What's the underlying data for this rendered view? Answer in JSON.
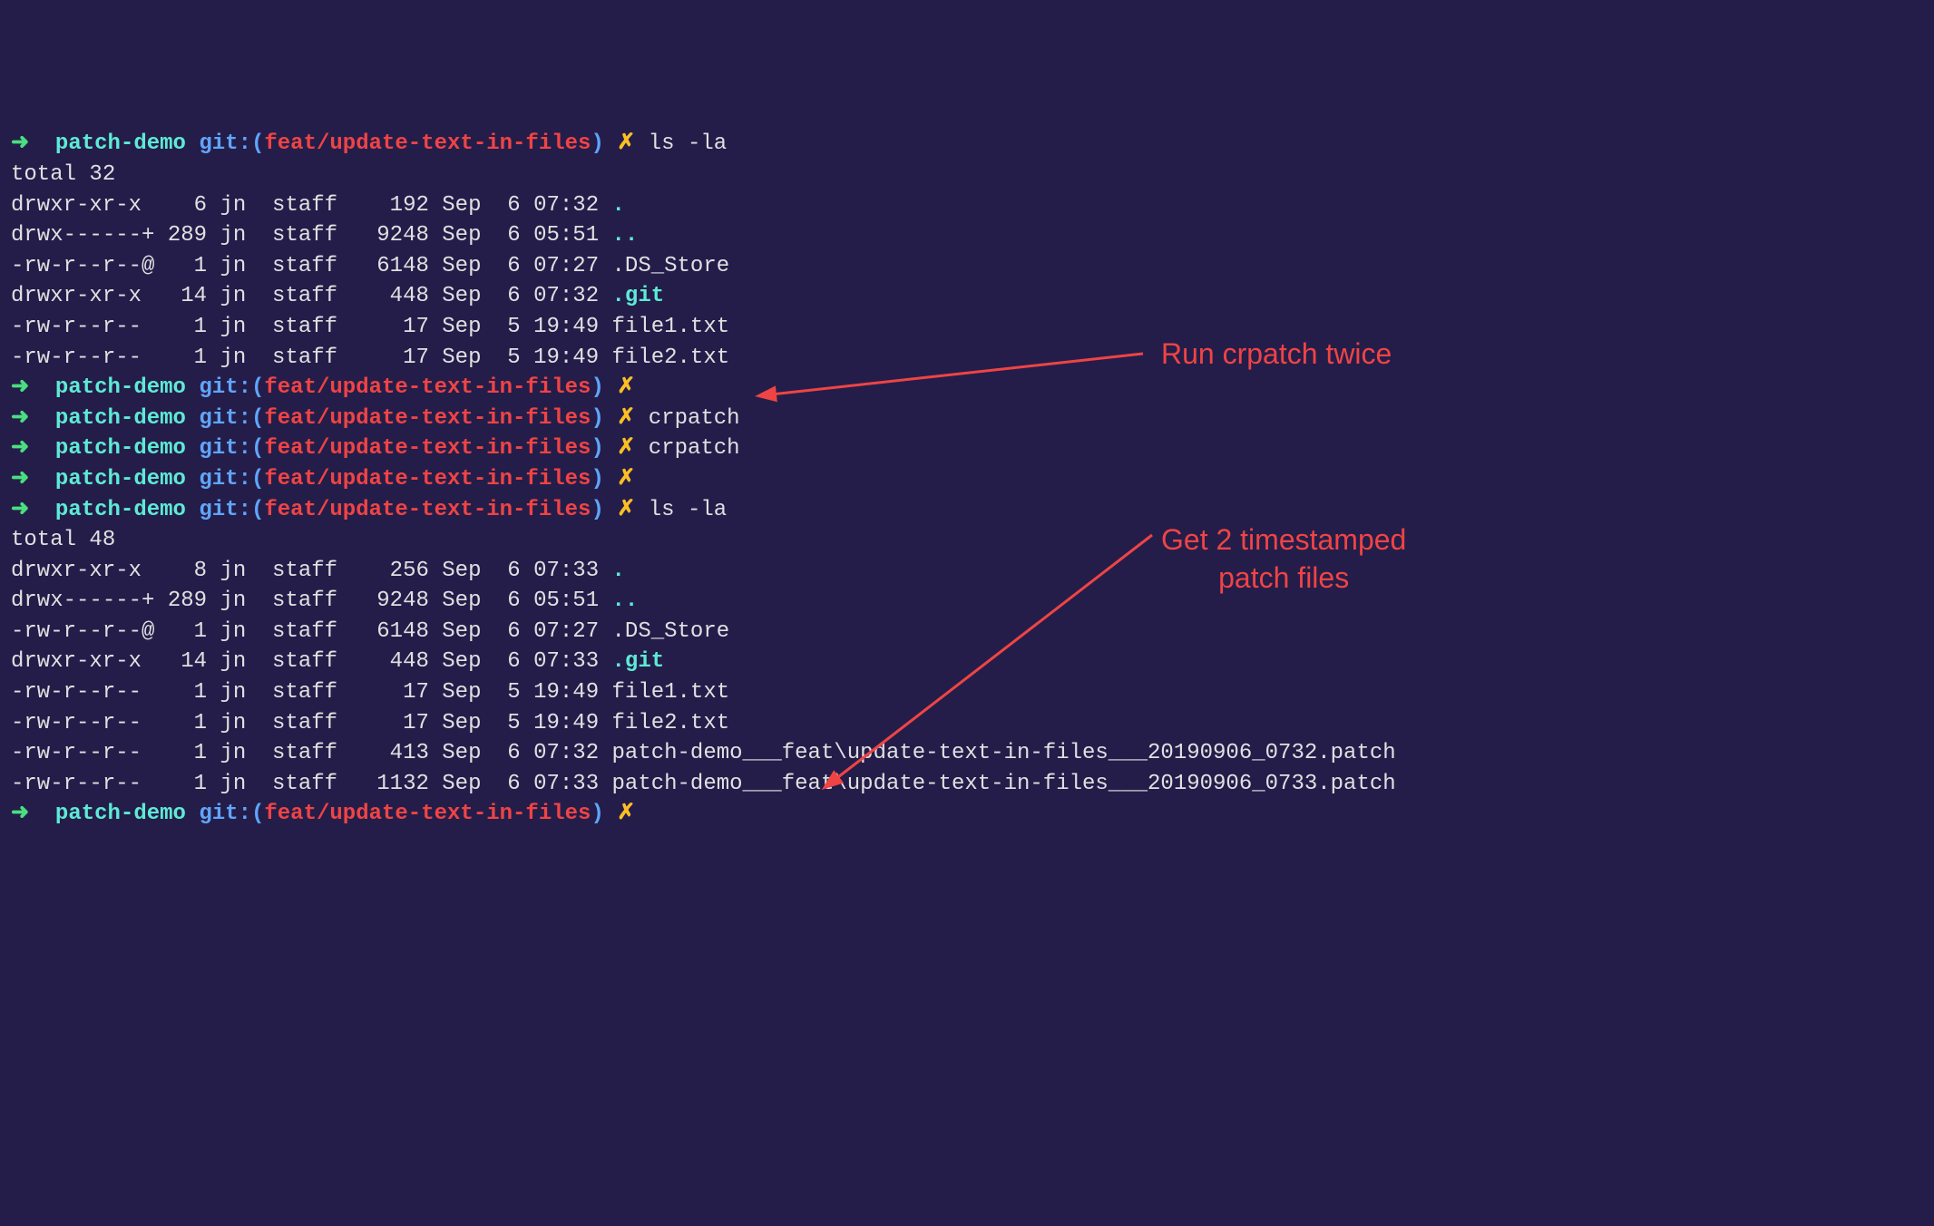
{
  "prompt": {
    "arrow": "➜",
    "dir": "patch-demo",
    "git_label": "git:(",
    "branch": "feat/update-text-in-files",
    "close_paren": ")",
    "x": "✗"
  },
  "commands": {
    "ls": "ls -la",
    "crpatch": "crpatch",
    "empty": ""
  },
  "ls1": {
    "total": "total 32",
    "rows": [
      {
        "perm": "drwxr-xr-x ",
        "links": "   6",
        "user": "jn",
        "group": "staff",
        "size": "   192",
        "date": "Sep  6 07:32",
        "name": ".",
        "is_dir": true
      },
      {
        "perm": "drwx------+",
        "links": " 289",
        "user": "jn",
        "group": "staff",
        "size": "  9248",
        "date": "Sep  6 05:51",
        "name": "..",
        "is_dir": true
      },
      {
        "perm": "-rw-r--r--@",
        "links": "   1",
        "user": "jn",
        "group": "staff",
        "size": "  6148",
        "date": "Sep  6 07:27",
        "name": ".DS_Store",
        "is_dir": false
      },
      {
        "perm": "drwxr-xr-x ",
        "links": "  14",
        "user": "jn",
        "group": "staff",
        "size": "   448",
        "date": "Sep  6 07:32",
        "name": ".git",
        "is_dir": true
      },
      {
        "perm": "-rw-r--r-- ",
        "links": "   1",
        "user": "jn",
        "group": "staff",
        "size": "    17",
        "date": "Sep  5 19:49",
        "name": "file1.txt",
        "is_dir": false
      },
      {
        "perm": "-rw-r--r-- ",
        "links": "   1",
        "user": "jn",
        "group": "staff",
        "size": "    17",
        "date": "Sep  5 19:49",
        "name": "file2.txt",
        "is_dir": false
      }
    ]
  },
  "ls2": {
    "total": "total 48",
    "rows": [
      {
        "perm": "drwxr-xr-x ",
        "links": "   8",
        "user": "jn",
        "group": "staff",
        "size": "   256",
        "date": "Sep  6 07:33",
        "name": ".",
        "is_dir": true
      },
      {
        "perm": "drwx------+",
        "links": " 289",
        "user": "jn",
        "group": "staff",
        "size": "  9248",
        "date": "Sep  6 05:51",
        "name": "..",
        "is_dir": true
      },
      {
        "perm": "-rw-r--r--@",
        "links": "   1",
        "user": "jn",
        "group": "staff",
        "size": "  6148",
        "date": "Sep  6 07:27",
        "name": ".DS_Store",
        "is_dir": false
      },
      {
        "perm": "drwxr-xr-x ",
        "links": "  14",
        "user": "jn",
        "group": "staff",
        "size": "   448",
        "date": "Sep  6 07:33",
        "name": ".git",
        "is_dir": true
      },
      {
        "perm": "-rw-r--r-- ",
        "links": "   1",
        "user": "jn",
        "group": "staff",
        "size": "    17",
        "date": "Sep  5 19:49",
        "name": "file1.txt",
        "is_dir": false
      },
      {
        "perm": "-rw-r--r-- ",
        "links": "   1",
        "user": "jn",
        "group": "staff",
        "size": "    17",
        "date": "Sep  5 19:49",
        "name": "file2.txt",
        "is_dir": false
      },
      {
        "perm": "-rw-r--r-- ",
        "links": "   1",
        "user": "jn",
        "group": "staff",
        "size": "   413",
        "date": "Sep  6 07:32",
        "name": "patch-demo___feat\\update-text-in-files___20190906_0732.patch",
        "is_dir": false
      },
      {
        "perm": "-rw-r--r-- ",
        "links": "   1",
        "user": "jn",
        "group": "staff",
        "size": "  1132",
        "date": "Sep  6 07:33",
        "name": "patch-demo___feat\\update-text-in-files___20190906_0733.patch",
        "is_dir": false
      }
    ]
  },
  "annotations": {
    "a1": "Run crpatch twice",
    "a2": "Get 2 timestamped\npatch files"
  }
}
